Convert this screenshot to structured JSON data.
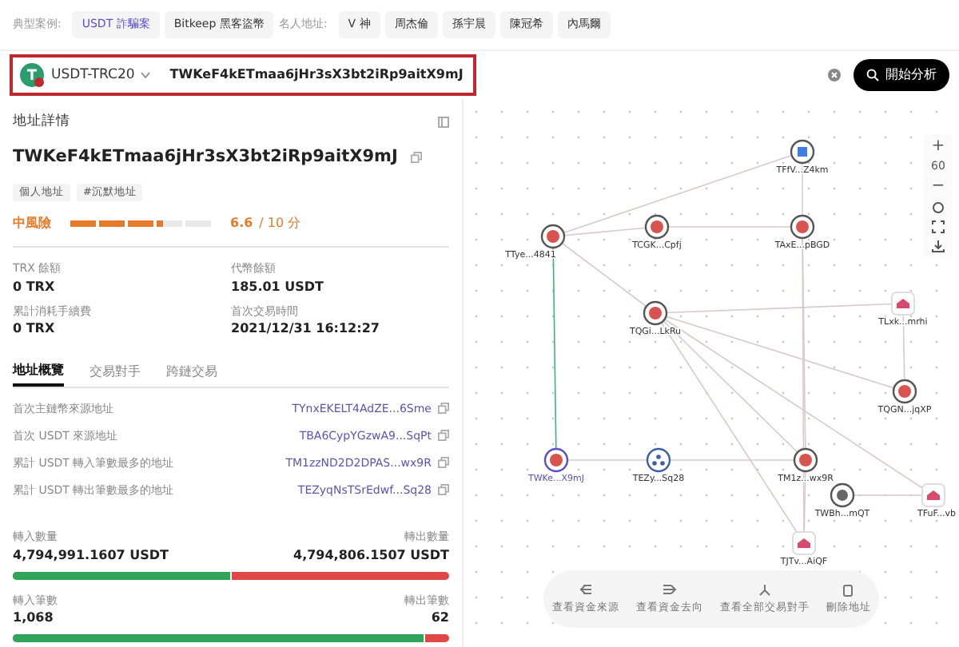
{
  "examples": {
    "label": "典型案例:",
    "items": [
      {
        "text": "USDT 詐騙案",
        "selected": true
      },
      {
        "text": "Bitkeep 黑客盜幣",
        "selected": false
      }
    ]
  },
  "celebrities": {
    "label": "名人地址:",
    "items": [
      {
        "text": "V 神",
        "selected": false
      },
      {
        "text": "周杰倫",
        "selected": false
      },
      {
        "text": "孫宇晨",
        "selected": false
      },
      {
        "text": "陳冠希",
        "selected": false
      },
      {
        "text": "內馬爾",
        "selected": false
      }
    ]
  },
  "search": {
    "network": "USDT-TRC20",
    "value": "TWKeF4kETmaa6jHr3sX3bt2iRp9aitX9mJ",
    "button": "開始分析"
  },
  "details": {
    "title": "地址詳情",
    "address": "TWKeF4kETmaa6jHr3sX3bt2iRp9aitX9mJ",
    "tags": [
      "個人地址",
      "#沉默地址"
    ],
    "risk": {
      "label": "中風險",
      "level": 0.66,
      "score": "6.6",
      "scale": "/ 10 分"
    },
    "stats": [
      {
        "label": "TRX 餘額",
        "value": "0 TRX"
      },
      {
        "label": "代幣餘額",
        "value": "185.01 USDT"
      },
      {
        "label": "累計消耗手續費",
        "value": "0 TRX"
      },
      {
        "label": "首次交易時間",
        "value": "2021/12/31 16:12:27"
      }
    ]
  },
  "tabs": [
    {
      "label": "地址概覽",
      "selected": true
    },
    {
      "label": "交易對手",
      "selected": false
    },
    {
      "label": "跨鏈交易",
      "selected": false
    }
  ],
  "overview": [
    {
      "label": "首次主鏈幣來源地址",
      "address": "TYnxEKELT4AdZE...6Sme"
    },
    {
      "label": "首次 USDT 來源地址",
      "address": "TBA6CypYGzwA9...SqPt"
    },
    {
      "label": "累計 USDT 轉入筆數最多的地址",
      "address": "TM1zzND2D2DPAS...wx9R"
    },
    {
      "label": "累計 USDT 轉出筆數最多的地址",
      "address": "TEZyqNsTSrEdwf...Sq28"
    }
  ],
  "flows": [
    {
      "in_label": "轉入數量",
      "in_value": "4,794,991.1607 USDT",
      "out_label": "轉出數量",
      "out_value": "4,794,806.1507 USDT",
      "level": 0.5
    },
    {
      "in_label": "轉入筆數",
      "in_value": "1,068",
      "out_label": "轉出筆數",
      "out_value": "62",
      "level": 0.945
    }
  ],
  "graph": {
    "nodes": [
      {
        "label": "TFfV...Z4km",
        "kind": "normal"
      },
      {
        "label": "TTye...4841",
        "kind": "risk"
      },
      {
        "label": "TCGK...Cpfj",
        "kind": "risk"
      },
      {
        "label": "TAxE...pBGD",
        "kind": "risk"
      },
      {
        "label": "TQGi...LkRu",
        "kind": "risk"
      },
      {
        "label": "TLxk...mrhi",
        "kind": "exchange"
      },
      {
        "label": "TQGN...jqXP",
        "kind": "risk"
      },
      {
        "label": "TWKe...X9mJ",
        "kind": "main"
      },
      {
        "label": "TEZy...Sq28",
        "kind": "contract"
      },
      {
        "label": "TM1z...wx9R",
        "kind": "risk"
      },
      {
        "label": "TWBh...mQT",
        "kind": "plain"
      },
      {
        "label": "TJTv...AiQF",
        "kind": "exchange"
      },
      {
        "label": "TFuF...vb",
        "kind": "exchange"
      }
    ],
    "zoom_in": "+",
    "zoom": "60",
    "zoom_out": "−",
    "actions": [
      {
        "label": "查看資金來源",
        "kind": "source"
      },
      {
        "label": "查看資金去向",
        "kind": "dest"
      },
      {
        "label": "查看全部交易對手",
        "kind": "all"
      },
      {
        "label": "刪除地址",
        "kind": "delete"
      }
    ]
  }
}
